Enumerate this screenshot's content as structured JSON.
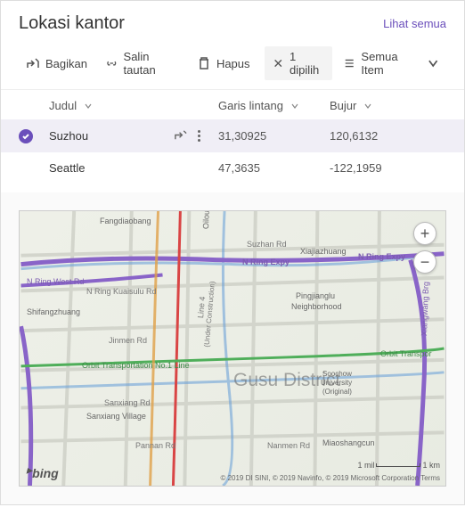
{
  "header": {
    "title": "Lokasi kantor",
    "see_all": "Lihat semua"
  },
  "toolbar": {
    "share": "Bagikan",
    "copy_link": "Salin tautan",
    "delete": "Hapus",
    "selected": "1 dipilih",
    "view": "Semua Item"
  },
  "columns": {
    "title": "Judul",
    "lat": "Garis lintang",
    "lon": "Bujur"
  },
  "rows": [
    {
      "title": "Suzhou",
      "lat": "31,30925",
      "lon": "120,6132",
      "selected": true
    },
    {
      "title": "Seattle",
      "lat": "47,3635",
      "lon": "-122,1959",
      "selected": false
    }
  ],
  "map": {
    "district": "Gusu District",
    "labels": {
      "fangdiaobang": "Fangdiaobang",
      "nring1": "N Ring Expy",
      "nring2": "N Ring Expy",
      "nringwest": "N Ring West Rd",
      "kuaisulu": "N Ring Kuaisulu Rd",
      "shifangzhuang": "Shifangzhuang",
      "oilou": "Oilou",
      "suzhan": "Suzhan Rd",
      "xiajia": "Xiajiazhuang",
      "pingjiang1": "Pingjianglu",
      "pingjiang2": "Neighborhood",
      "jinmen": "Jinmen Rd",
      "line4a": "Line 4",
      "line4b": "(Under Construction)",
      "orbit1": "Orbit Transportation No.1 Line",
      "orbit2": "Orbit Transpor",
      "sanxiang": "Sanxiang Rd",
      "sanxiangv": "Sanxiang Village",
      "pannan": "Pannan Rd",
      "soochow1": "Soochow",
      "soochow2": "University",
      "soochow3": "(Original)",
      "nanmen": "Nanmen Rd",
      "miaoshang": "Miaoshangcun",
      "xiangwang": "Xiangwang Brg"
    },
    "bing": "bing",
    "scale_mi": "1 mil",
    "scale_km": "1 km",
    "copyright": "© 2019 DI SINI, © 2019 Navinfo, © 2019 Microsoft Corporation Terms"
  }
}
